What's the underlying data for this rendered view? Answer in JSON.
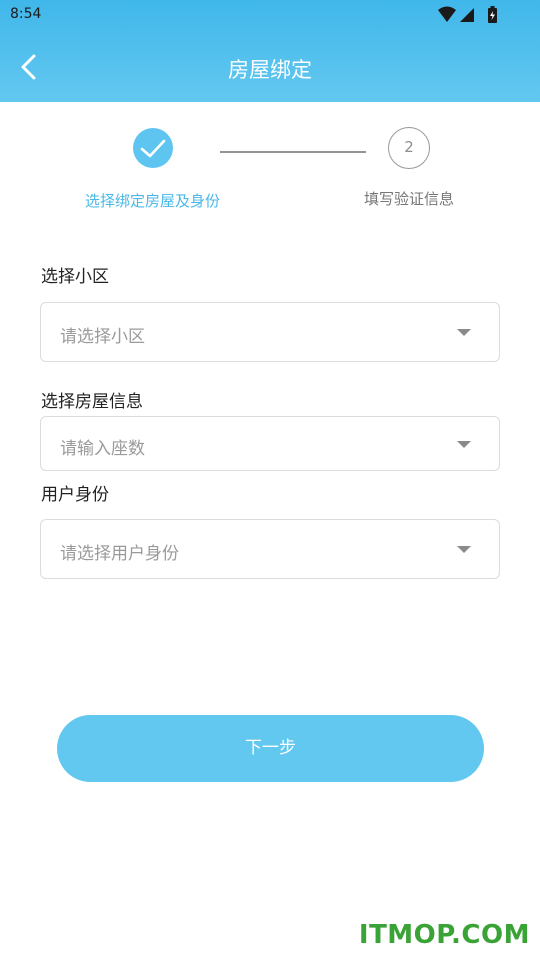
{
  "status_bar": {
    "time": "8:54"
  },
  "header": {
    "title": "房屋绑定"
  },
  "steps": {
    "step1_label": "选择绑定房屋及身份",
    "step2_number": "2",
    "step2_label": "填写验证信息"
  },
  "form": {
    "community": {
      "label": "选择小区",
      "placeholder": "请选择小区"
    },
    "house": {
      "label": "选择房屋信息",
      "placeholder": "请输入座数"
    },
    "identity": {
      "label": "用户身份",
      "placeholder": "请选择用户身份"
    }
  },
  "next_button": "下一步",
  "watermark": "ITMOP.COM",
  "colors": {
    "accent": "#63c8f0",
    "header_top": "#40b7ea",
    "watermark": "#3aa335"
  }
}
